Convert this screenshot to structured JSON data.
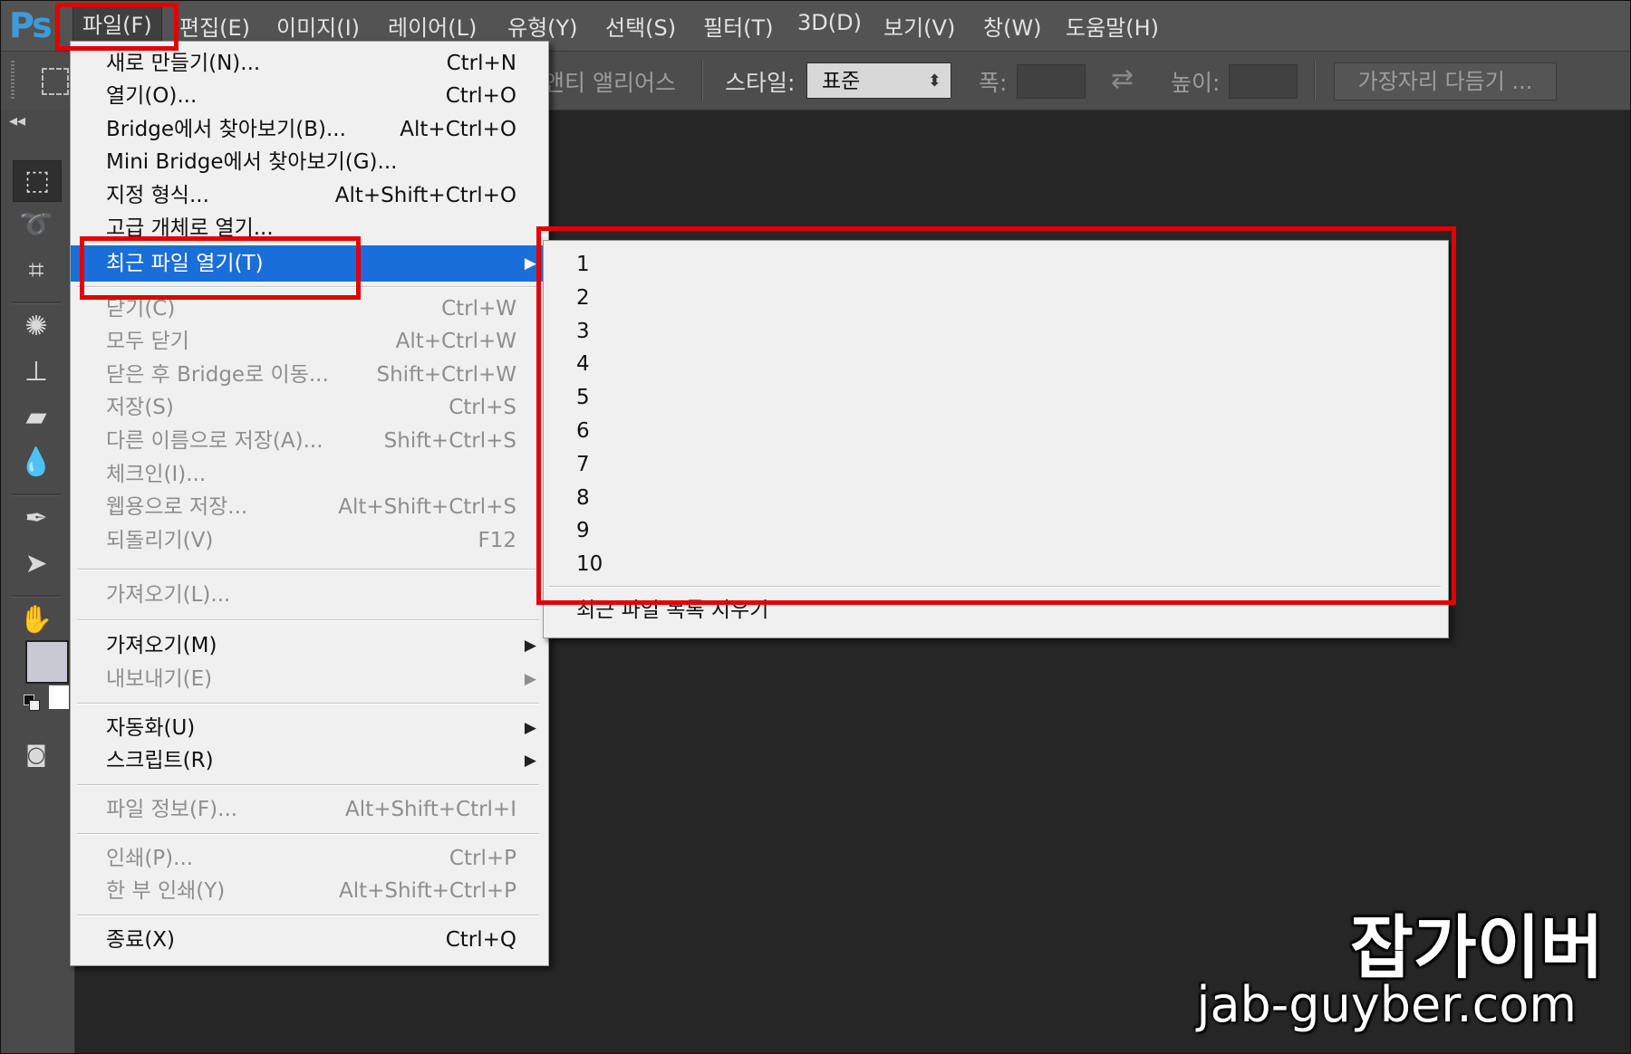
{
  "app": {
    "logo": "Ps"
  },
  "menubar": {
    "items": [
      "파일(F)",
      "편집(E)",
      "이미지(I)",
      "레이어(L)",
      "유형(Y)",
      "선택(S)",
      "필터(T)",
      "3D(D)",
      "보기(V)",
      "창(W)",
      "도움말(H)"
    ],
    "active_index": 0
  },
  "options_bar": {
    "antialias_label": "앤티 앨리어스",
    "style_label": "스타일:",
    "style_value": "표준",
    "width_label": "폭:",
    "height_label": "높이:",
    "refine_edge_button": "가장자리 다듬기 ..."
  },
  "file_menu": {
    "items": [
      {
        "label": "새로 만들기(N)...",
        "shortcut": "Ctrl+N",
        "disabled": false
      },
      {
        "label": "열기(O)...",
        "shortcut": "Ctrl+O",
        "disabled": false
      },
      {
        "label": "Bridge에서 찾아보기(B)...",
        "shortcut": "Alt+Ctrl+O",
        "disabled": false
      },
      {
        "label": "Mini Bridge에서 찾아보기(G)...",
        "shortcut": "",
        "disabled": false
      },
      {
        "label": "지정 형식...",
        "shortcut": "Alt+Shift+Ctrl+O",
        "disabled": false
      },
      {
        "label": "고급 개체로 열기...",
        "shortcut": "",
        "disabled": false
      },
      {
        "label": "최근 파일 열기(T)",
        "shortcut": "",
        "disabled": false,
        "highlighted": true,
        "submenu": true
      },
      {
        "label": "닫기(C)",
        "shortcut": "Ctrl+W",
        "disabled": true
      },
      {
        "label": "모두 닫기",
        "shortcut": "Alt+Ctrl+W",
        "disabled": true
      },
      {
        "label": "닫은 후 Bridge로 이동...",
        "shortcut": "Shift+Ctrl+W",
        "disabled": true
      },
      {
        "label": "저장(S)",
        "shortcut": "Ctrl+S",
        "disabled": true
      },
      {
        "label": "다른 이름으로 저장(A)...",
        "shortcut": "Shift+Ctrl+S",
        "disabled": true
      },
      {
        "label": "체크인(I)...",
        "shortcut": "",
        "disabled": true
      },
      {
        "label": "웹용으로 저장...",
        "shortcut": "Alt+Shift+Ctrl+S",
        "disabled": true
      },
      {
        "label": "되돌리기(V)",
        "shortcut": "F12",
        "disabled": true
      },
      {
        "label": "가져오기(L)...",
        "shortcut": "",
        "disabled": true
      },
      {
        "label": "가져오기(M)",
        "shortcut": "",
        "disabled": false,
        "submenu": true
      },
      {
        "label": "내보내기(E)",
        "shortcut": "",
        "disabled": true,
        "submenu": true
      },
      {
        "label": "자동화(U)",
        "shortcut": "",
        "disabled": false,
        "submenu": true
      },
      {
        "label": "스크립트(R)",
        "shortcut": "",
        "disabled": false,
        "submenu": true
      },
      {
        "label": "파일 정보(F)...",
        "shortcut": "Alt+Shift+Ctrl+I",
        "disabled": true
      },
      {
        "label": "인쇄(P)...",
        "shortcut": "Ctrl+P",
        "disabled": true
      },
      {
        "label": "한 부 인쇄(Y)",
        "shortcut": "Alt+Shift+Ctrl+P",
        "disabled": true
      },
      {
        "label": "종료(X)",
        "shortcut": "Ctrl+Q",
        "disabled": false
      }
    ]
  },
  "recent_files": {
    "items": [
      "1",
      "2",
      "3",
      "4",
      "5",
      "6",
      "7",
      "8",
      "9",
      "10"
    ],
    "clear_label": "최근 파일 목록 지우기"
  },
  "tools": [
    "rectangular-marquee",
    "lasso",
    "crop",
    "patch",
    "stamp",
    "eraser",
    "blur",
    "pen",
    "path-select",
    "hand",
    "colors",
    "quick-mask"
  ],
  "watermark": {
    "title": "잡가이버",
    "url": "jab-guyber.com"
  },
  "colors": {
    "highlight": "#1a6ed8",
    "annotation_red": "#e30000",
    "foreground_swatch": "#c9c9d3"
  }
}
